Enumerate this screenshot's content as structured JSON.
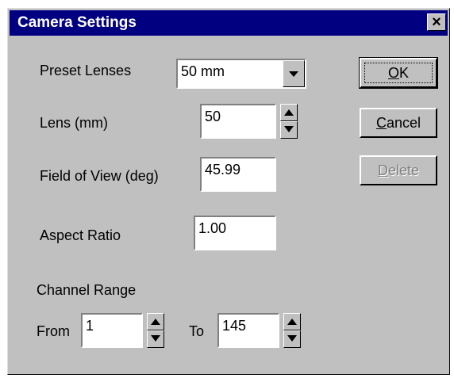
{
  "window": {
    "title": "Camera Settings",
    "close_glyph": "×"
  },
  "preset_lenses": {
    "label": "Preset Lenses",
    "value": "50 mm"
  },
  "lens": {
    "label": "Lens (mm)",
    "value": "50"
  },
  "field_of_view": {
    "label": "Field of View (deg)",
    "value": "45.99"
  },
  "aspect_ratio": {
    "label": "Aspect Ratio",
    "value": "1.00"
  },
  "channel_range": {
    "label": "Channel Range",
    "from_label": "From",
    "from_value": "1",
    "to_label": "To",
    "to_value": "145"
  },
  "buttons": {
    "ok": {
      "accel": "O",
      "rest": "K"
    },
    "cancel": {
      "accel": "C",
      "rest": "ancel"
    },
    "delete": {
      "accel": "D",
      "rest": "elete",
      "disabled": true
    }
  },
  "icons": {
    "dropdown": "chevron-down-icon",
    "spin_up": "arrow-up-icon",
    "spin_down": "arrow-down-icon"
  }
}
